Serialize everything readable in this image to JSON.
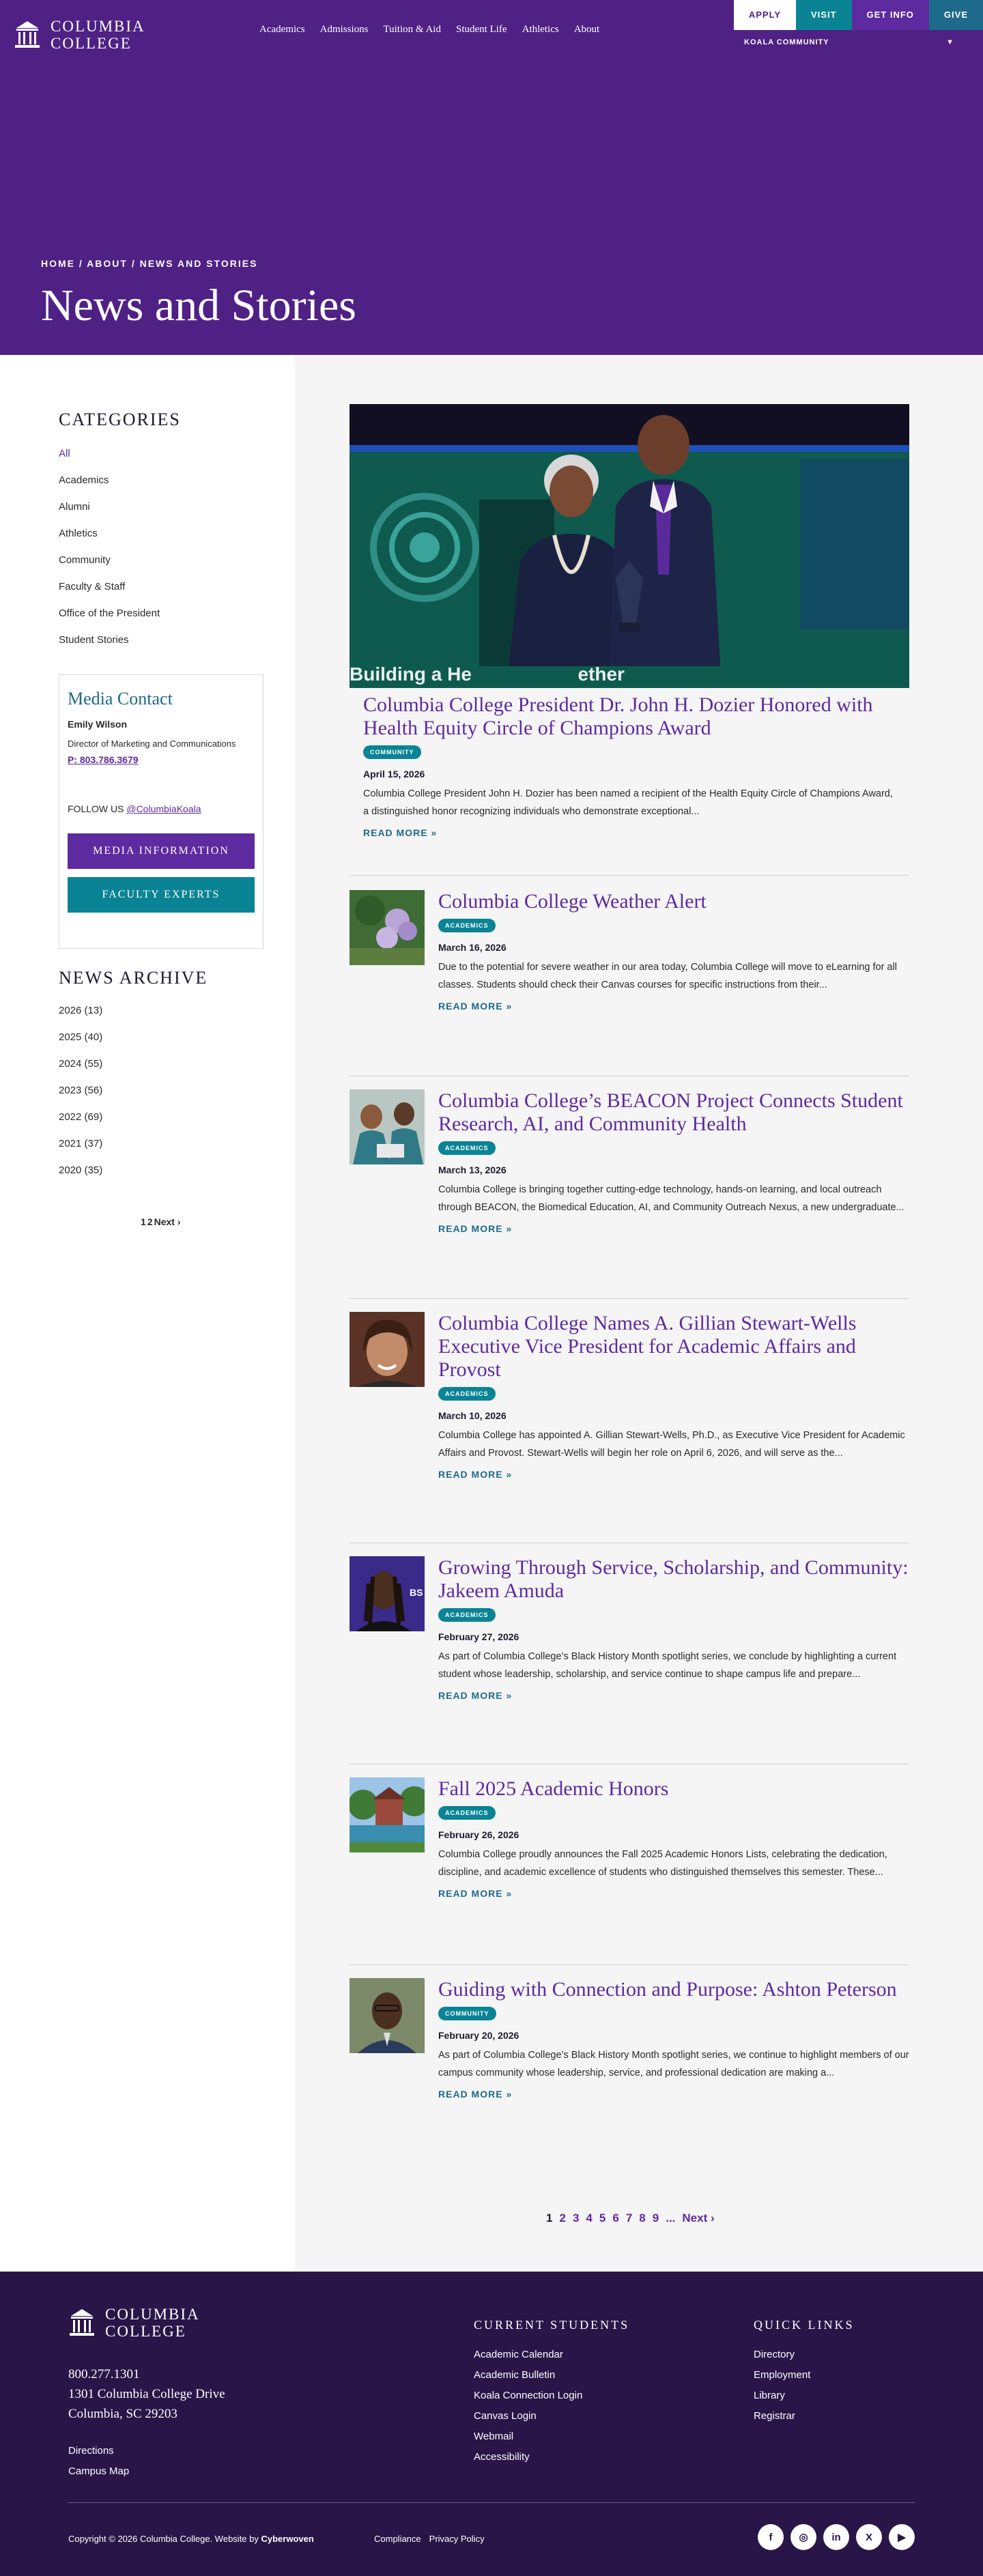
{
  "header": {
    "logo": {
      "line1": "COLUMBIA",
      "line2": "COLLEGE"
    },
    "nav": [
      "Academics",
      "Admissions",
      "Tuition & Aid",
      "Student Life",
      "Athletics",
      "About"
    ],
    "cta": {
      "apply": "APPLY",
      "visit": "VISIT",
      "info": "GET INFO",
      "give": "GIVE"
    },
    "community_select": "KOALA COMMUNITY"
  },
  "hero": {
    "breadcrumb": [
      "HOME",
      "ABOUT",
      "NEWS AND STORIES"
    ],
    "separator": "/",
    "title": "News and Stories"
  },
  "sidebar": {
    "categories_title": "CATEGORIES",
    "categories": [
      "All",
      "Academics",
      "Alumni",
      "Athletics",
      "Community",
      "Faculty & Staff",
      "Office of the President",
      "Student Stories"
    ],
    "media": {
      "title": "Media Contact",
      "name": "Emily Wilson",
      "role": "Director of Marketing and Communications",
      "phone": "P: 803.786.3679",
      "follow_label": "FOLLOW US",
      "follow_handle": "@ColumbiaKoala",
      "btn_info": "MEDIA INFORMATION",
      "btn_experts": "FACULTY EXPERTS"
    },
    "archive_title": "NEWS ARCHIVE",
    "archive": [
      "2026 (13)",
      "2025 (40)",
      "2024 (55)",
      "2023 (56)",
      "2022 (69)",
      "2021 (37)",
      "2020 (35)"
    ],
    "pager": {
      "p1": "1",
      "p2": "2",
      "next": "Next ›"
    }
  },
  "featured": {
    "title": "Columbia College President Dr. John H. Dozier Honored with Health Equity Circle of Champions Award",
    "tag": "COMMUNITY",
    "date": "April 15, 2026",
    "excerpt": "Columbia College President John H. Dozier has been named a recipient of the Health Equity Circle of Champions Award, a distinguished honor recognizing individuals who demonstrate exceptional...",
    "read_more": "READ MORE »",
    "image_text": "Building a He                    ether"
  },
  "articles": [
    {
      "title": "Columbia College Weather Alert",
      "tag": "ACADEMICS",
      "date": "March 16, 2026",
      "excerpt": "Due to the potential for severe weather in our area today, Columbia College will move to eLearning for all classes. Students should check their Canvas courses for specific instructions from their...",
      "read_more": "READ MORE »"
    },
    {
      "title": "Columbia College’s BEACON Project Connects Student Research, AI, and Community Health",
      "tag": "ACADEMICS",
      "date": "March 13, 2026",
      "excerpt": "Columbia College is bringing together cutting-edge technology, hands-on learning, and local outreach through BEACON, the Biomedical Education, AI, and Community Outreach Nexus, a new undergraduate...",
      "read_more": "READ MORE »"
    },
    {
      "title": "Columbia College Names A. Gillian Stewart-Wells Executive Vice President for Academic Affairs and Provost",
      "tag": "ACADEMICS",
      "date": "March 10, 2026",
      "excerpt": "Columbia College has appointed A. Gillian Stewart-Wells, Ph.D., as Executive Vice President for Academic Affairs and Provost. Stewart-Wells will begin her role on April 6, 2026, and will serve as the...",
      "read_more": "READ MORE »"
    },
    {
      "title": "Growing Through Service, Scholarship, and Community: Jakeem Amuda",
      "tag": "ACADEMICS",
      "date": "February 27, 2026",
      "excerpt": "As part of Columbia College’s Black History Month spotlight series, we conclude by highlighting a current student whose leadership, scholarship, and service continue to shape campus life and prepare...",
      "read_more": "READ MORE »"
    },
    {
      "title": "Fall 2025 Academic Honors",
      "tag": "ACADEMICS",
      "date": "February 26, 2026",
      "excerpt": "Columbia College proudly announces the Fall 2025 Academic Honors Lists, celebrating the dedication, discipline, and academic excellence of students who distinguished themselves this semester. These...",
      "read_more": "READ MORE »"
    },
    {
      "title": "Guiding with Connection and Purpose: Ashton Peterson",
      "tag": "COMMUNITY",
      "date": "February 20, 2026",
      "excerpt": "As part of Columbia College’s Black History Month spotlight series, we continue to highlight members of our campus community whose leadership, service, and professional dedication are making a...",
      "read_more": "READ MORE »"
    }
  ],
  "pagination": {
    "pages": [
      "1",
      "2",
      "3",
      "4",
      "5",
      "6",
      "7",
      "8",
      "9"
    ],
    "ellipsis": "...",
    "next": "Next ›"
  },
  "footer": {
    "logo": {
      "line1": "COLUMBIA",
      "line2": "COLLEGE"
    },
    "phone": "800.277.1301",
    "address1": "1301 Columbia College Drive",
    "address2": "Columbia, SC 29203",
    "links": [
      "Directions",
      "Campus Map"
    ],
    "current_students_title": "CURRENT STUDENTS",
    "current_students": [
      "Academic Calendar",
      "Academic Bulletin",
      "Koala Connection Login",
      "Canvas Login",
      "Webmail",
      "Accessibility"
    ],
    "quick_links_title": "QUICK LINKS",
    "quick_links": [
      "Directory",
      "Employment",
      "Library",
      "Registrar"
    ],
    "copyright": "Copyright © 2026 Columbia College. Website by",
    "credit": "Cyberwoven",
    "legal": [
      "Compliance",
      "Privacy Policy"
    ],
    "social": [
      "f",
      "◎",
      "in",
      "X",
      "▶"
    ]
  },
  "colors": {
    "purple": "#4f2184",
    "accent_purple": "#5e2aa0",
    "teal": "#0a8494",
    "blue": "#1e6a8a",
    "footer": "#2a1548"
  }
}
